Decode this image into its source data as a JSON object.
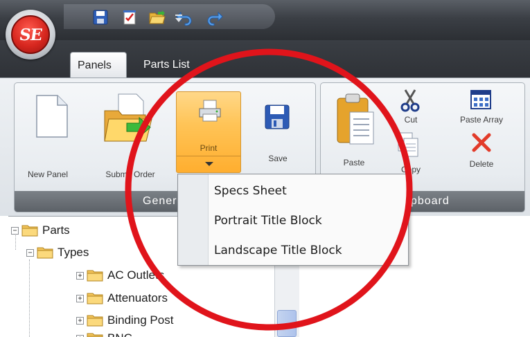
{
  "app": {
    "orb_text": "SE"
  },
  "quick_access": {
    "icons": [
      "save-icon",
      "checklist-icon",
      "open-folder-icon",
      "undo-icon",
      "redo-icon",
      "customize-dropdown-icon"
    ]
  },
  "tabs": [
    {
      "label": "Panels",
      "active": true
    },
    {
      "label": "Parts List",
      "active": false
    }
  ],
  "ribbon": {
    "general": {
      "group_label": "General",
      "buttons": {
        "new_panel": "New Panel",
        "submit_order": "Submit Order",
        "print": "Print",
        "save": "Save"
      }
    },
    "clipboard": {
      "group_label": "Clipboard",
      "buttons": {
        "paste": "Paste",
        "cut": "Cut",
        "copy": "Copy",
        "paste_array": "Paste Array",
        "delete": "Delete"
      }
    }
  },
  "print_menu": {
    "items": [
      "Specs Sheet",
      "Portrait Title Block",
      "Landscape Title Block"
    ]
  },
  "tree": {
    "nodes": [
      {
        "label": "Parts",
        "level": 0,
        "expanded": true
      },
      {
        "label": "Types",
        "level": 1,
        "expanded": true
      },
      {
        "label": "AC Outlets",
        "level": 2,
        "expanded": false
      },
      {
        "label": "Attenuators",
        "level": 2,
        "expanded": false
      },
      {
        "label": "Binding Post",
        "level": 2,
        "expanded": false
      },
      {
        "label": "BNC",
        "level": 2,
        "expanded": false
      }
    ]
  },
  "colors": {
    "accent_orange": "#ffc457",
    "highlight_red": "#e0141b",
    "orb_red": "#d7271f"
  }
}
